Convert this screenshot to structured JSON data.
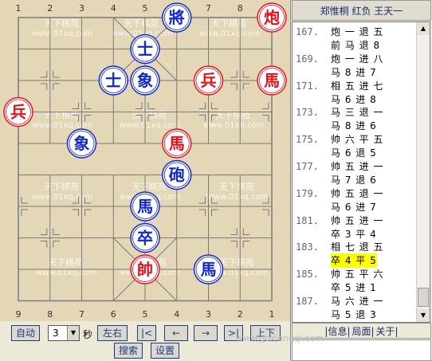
{
  "header": {
    "title": "郑惟桐 红负 王天一"
  },
  "board": {
    "top_files": [
      "1",
      "2",
      "3",
      "4",
      "5",
      "6",
      "7",
      "8",
      "9"
    ],
    "bottom_files": [
      "9",
      "8",
      "7",
      "6",
      "5",
      "4",
      "3",
      "2",
      "1"
    ],
    "watermark": "www.01xq.com",
    "watermark_logo": "天下棋苑",
    "pieces": [
      {
        "name": "red-cannon",
        "char": "炮",
        "side": "red",
        "col": 8,
        "row": 0
      },
      {
        "name": "blue-general",
        "char": "將",
        "side": "blue",
        "col": 5,
        "row": 0
      },
      {
        "name": "blue-advisor-top",
        "char": "士",
        "side": "blue",
        "col": 4,
        "row": 1
      },
      {
        "name": "blue-advisor-left",
        "char": "士",
        "side": "blue",
        "col": 3,
        "row": 2
      },
      {
        "name": "blue-elephant-center",
        "char": "象",
        "side": "blue",
        "col": 4,
        "row": 2
      },
      {
        "name": "red-pawn-center",
        "char": "兵",
        "side": "red",
        "col": 6,
        "row": 2
      },
      {
        "name": "red-horse-right",
        "char": "馬",
        "side": "red",
        "col": 8,
        "row": 2
      },
      {
        "name": "red-pawn-left",
        "char": "兵",
        "side": "red",
        "col": 0,
        "row": 3
      },
      {
        "name": "blue-elephant-left",
        "char": "象",
        "side": "blue",
        "col": 2,
        "row": 4
      },
      {
        "name": "red-horse-center",
        "char": "馬",
        "side": "red",
        "col": 5,
        "row": 4
      },
      {
        "name": "blue-cannon",
        "char": "砲",
        "side": "blue",
        "col": 5,
        "row": 5
      },
      {
        "name": "blue-horse-center",
        "char": "馬",
        "side": "blue",
        "col": 4,
        "row": 6
      },
      {
        "name": "blue-pawn",
        "char": "卒",
        "side": "blue",
        "col": 4,
        "row": 7
      },
      {
        "name": "red-king",
        "char": "帥",
        "side": "red",
        "col": 4,
        "row": 8
      },
      {
        "name": "blue-horse-right",
        "char": "馬",
        "side": "blue",
        "col": 6,
        "row": 8
      }
    ]
  },
  "colors": {
    "red": "#e0141e",
    "blue": "#1428c8",
    "board_bg": "#e3d7b8",
    "highlight": "#ffff00"
  },
  "controls": {
    "auto_label": "自动",
    "speed_value": "3",
    "seconds_label": "秒",
    "flip_label": "左右",
    "first_label": "|<",
    "prev_label": "←",
    "next_label": "→",
    "last_label": ">|",
    "updown_label": "上下",
    "search_label": "搜索",
    "settings_label": "设置"
  },
  "moves": [
    {
      "num": "167.",
      "text": "炮 一 退 五"
    },
    {
      "num": "",
      "text": "前 马 退 8"
    },
    {
      "num": "169.",
      "text": "炮 一 进 八"
    },
    {
      "num": "",
      "text": "马 8 进 7"
    },
    {
      "num": "171.",
      "text": "相 五 进 七"
    },
    {
      "num": "",
      "text": "马 6 进 8"
    },
    {
      "num": "173.",
      "text": "马 三 退 一"
    },
    {
      "num": "",
      "text": "马 8 进 6"
    },
    {
      "num": "175.",
      "text": "帅 六 平 五"
    },
    {
      "num": "",
      "text": "马 6 退 5"
    },
    {
      "num": "177.",
      "text": "帅 五 进 一"
    },
    {
      "num": "",
      "text": "马 7 退 6"
    },
    {
      "num": "179.",
      "text": "帅 五 退 一"
    },
    {
      "num": "",
      "text": "马 6 进 7"
    },
    {
      "num": "181.",
      "text": "帅 五 进 一"
    },
    {
      "num": "",
      "text": "卒 3 平 4"
    },
    {
      "num": "183.",
      "text": "相 七 退 五"
    },
    {
      "num": "",
      "text": "卒 4 平 5",
      "current": true
    },
    {
      "num": "185.",
      "text": "帅 五 平 六"
    },
    {
      "num": "",
      "text": "卒 5 进 1"
    },
    {
      "num": "187.",
      "text": "马 六 进 一"
    },
    {
      "num": "",
      "text": "马 5 退 3"
    }
  ],
  "tabs": {
    "info": "|信息|",
    "screen": "局面|",
    "about": "关于|"
  },
  "watermark_url": "www.goxiangqi.com"
}
